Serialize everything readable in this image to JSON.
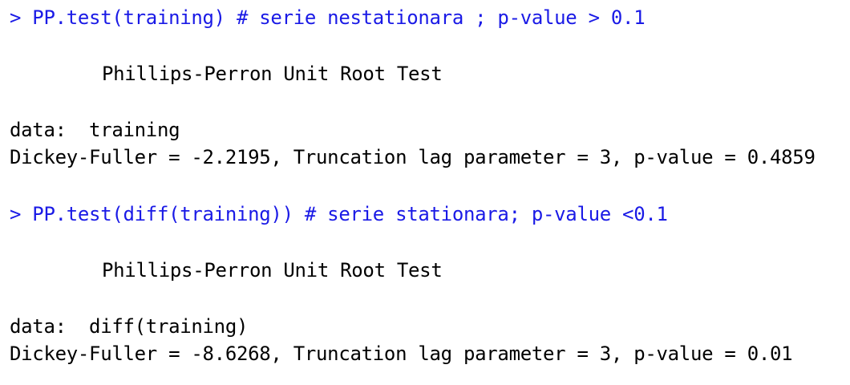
{
  "console": {
    "block1": {
      "command": "> PP.test(training) # serie nestationara ; p-value > 0.1",
      "test_title": "Phillips-Perron Unit Root Test",
      "data_line": "data:  training",
      "stats_line": "Dickey-Fuller = -2.2195, Truncation lag parameter = 3, p-value = 0.4859"
    },
    "block2": {
      "command": "> PP.test(diff(training)) # serie stationara; p-value <0.1",
      "test_title": "Phillips-Perron Unit Root Test",
      "data_line": "data:  diff(training)",
      "stats_line": "Dickey-Fuller = -8.6268, Truncation lag parameter = 3, p-value = 0.01"
    },
    "colors": {
      "command": "#1a1ae6",
      "output": "#000000",
      "background": "#ffffff"
    }
  }
}
